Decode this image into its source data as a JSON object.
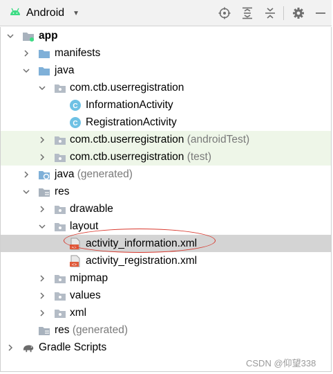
{
  "toolbar": {
    "view_label": "Android",
    "view_icon": "android-icon",
    "buttons": [
      "locate-icon",
      "expand-all-icon",
      "collapse-all-icon",
      "gear-icon",
      "minimize-icon"
    ]
  },
  "tree": {
    "app": "app",
    "manifests": "manifests",
    "java": "java",
    "pkg_main": "com.ctb.userregistration",
    "information_activity": "InformationActivity",
    "registration_activity": "RegistrationActivity",
    "pkg_android_test": "com.ctb.userregistration",
    "pkg_android_test_suffix": "(androidTest)",
    "pkg_test": "com.ctb.userregistration",
    "pkg_test_suffix": "(test)",
    "java_generated": "java",
    "java_generated_suffix": "(generated)",
    "res": "res",
    "drawable": "drawable",
    "layout": "layout",
    "activity_information": "activity_information.xml",
    "activity_registration": "activity_registration.xml",
    "mipmap": "mipmap",
    "values": "values",
    "xml": "xml",
    "res_generated": "res",
    "res_generated_suffix": "(generated)",
    "gradle_scripts": "Gradle Scripts"
  },
  "watermark": "CSDN @仰望338",
  "colors": {
    "selected_row": "#d4d4d4",
    "test_row": "#eef6e8",
    "annotation": "#d9362b",
    "folder": "#7fb0d8",
    "android": "#3ddc84"
  }
}
